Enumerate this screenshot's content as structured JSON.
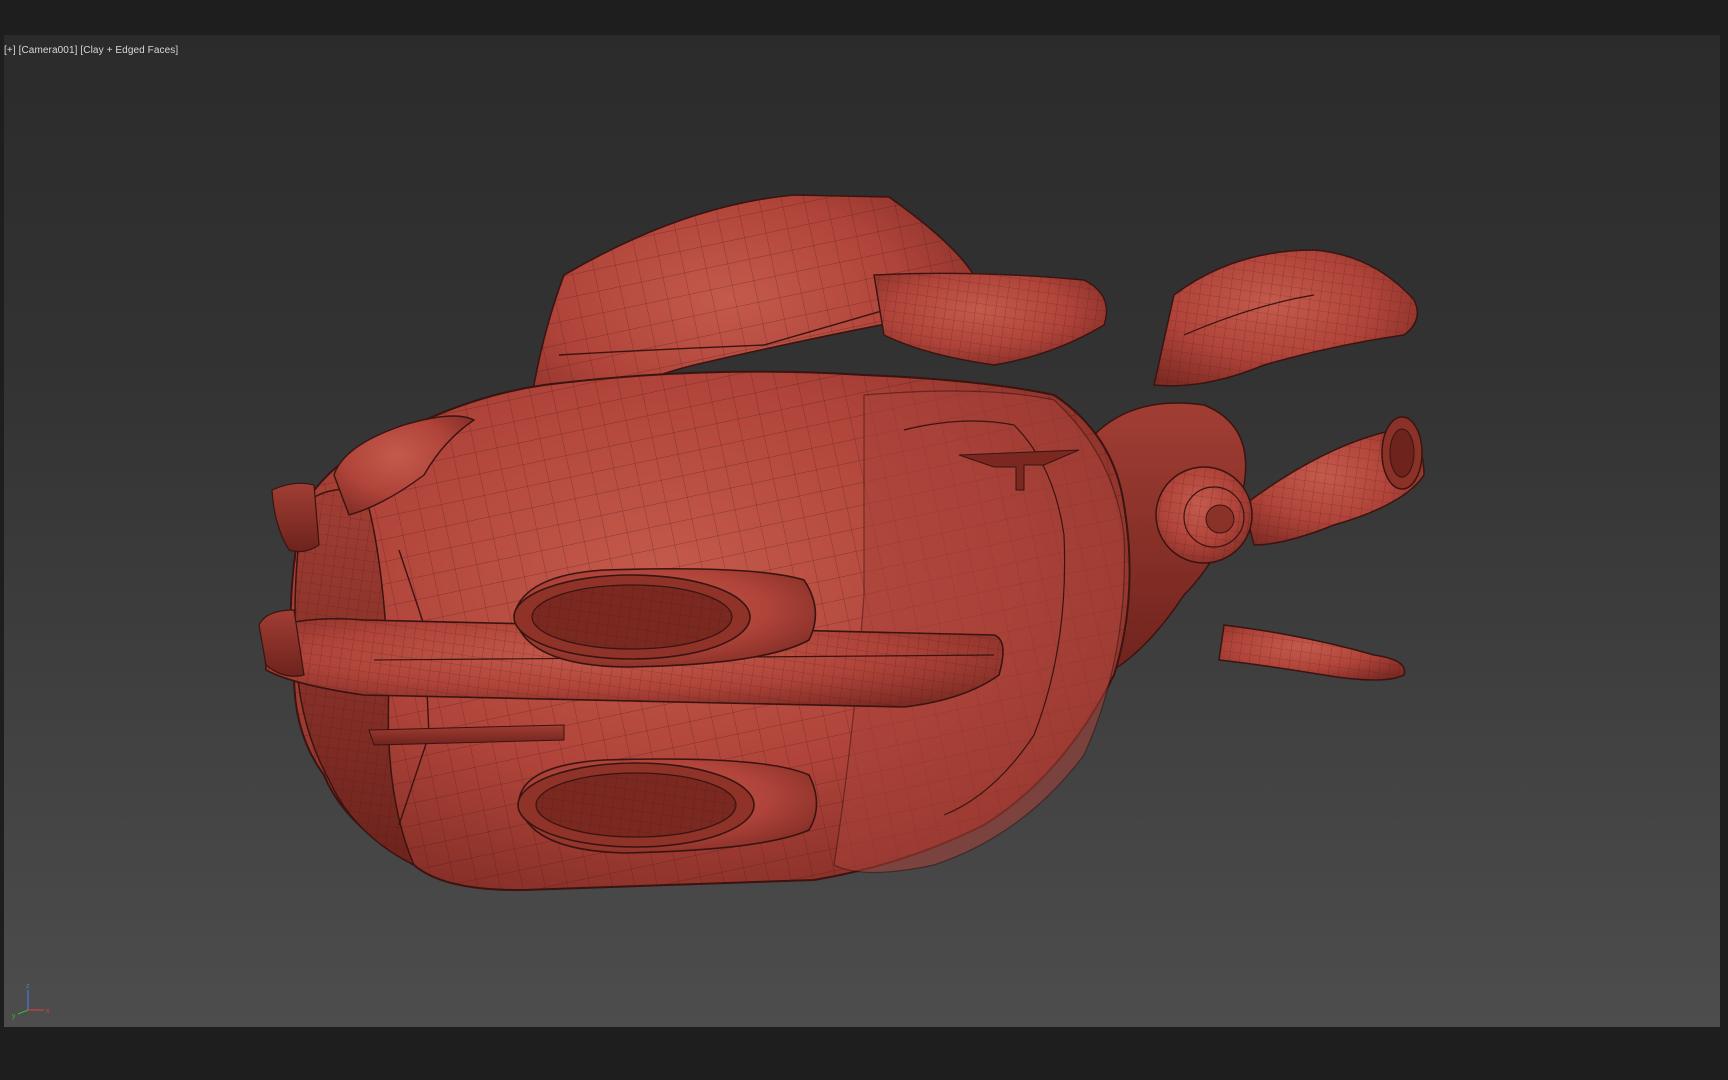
{
  "viewport": {
    "label_parts": [
      "[+]",
      "[Camera001]",
      "[Clay + Edged Faces]"
    ]
  },
  "scene": {
    "object": "spaceship-model",
    "shading": "clay",
    "clay_color": "#b5473b",
    "edge_color": "#3a1410",
    "background_top": "#2b2b2b",
    "background_bottom": "#4d4d4d"
  },
  "axis_gizmo": {
    "z_label": "z",
    "x_label": "x",
    "y_label": "y",
    "colors": {
      "x": "#d04040",
      "y": "#40b040",
      "z": "#4a7ad8"
    }
  }
}
